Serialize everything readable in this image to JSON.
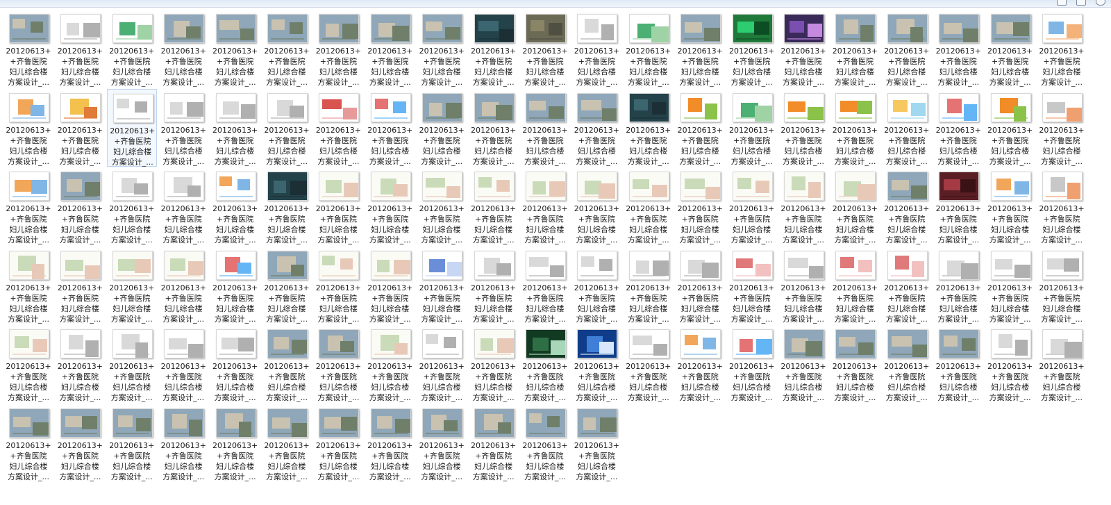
{
  "toolbar": {
    "items": [
      "",
      "",
      ""
    ],
    "icons": [
      "view-icon",
      "preview-pane-icon",
      "help-icon"
    ]
  },
  "file_label": {
    "line1": "20120613+",
    "line2": "+齐鲁医院",
    "line3": "妇儿综合楼",
    "line4": "方案设计_..."
  },
  "grid": {
    "columns": 21,
    "rows": [
      21,
      21,
      21,
      21,
      21,
      12
    ],
    "selected": [
      4,
      23
    ],
    "thumb_styles": [
      "photo",
      "doc",
      "doc-green",
      "photo",
      "photo",
      "photo",
      "photo",
      "photo",
      "photo",
      "dark",
      "aerial",
      "doc",
      "doc-green",
      "photo",
      "green",
      "purple",
      "photo",
      "photo",
      "photo",
      "photo",
      "diagram-blue",
      "doc-color",
      "diagram-yellow",
      "doc",
      "doc",
      "doc",
      "doc",
      "diagram-red",
      "diagram-color",
      "photo",
      "photo",
      "photo",
      "photo",
      "dark",
      "doc-orange",
      "doc-green",
      "doc-orange",
      "doc-orange",
      "doc-yellow",
      "diagram-color",
      "doc-orange",
      "doc-gray",
      "doc-color",
      "photo",
      "doc",
      "doc",
      "doc-color",
      "dark",
      "plan",
      "plan",
      "plan",
      "plan",
      "plan",
      "plan",
      "plan",
      "plan",
      "plan",
      "plan",
      "plan",
      "photo",
      "red",
      "doc-color",
      "doc-gray",
      "plan",
      "plan",
      "plan",
      "plan",
      "diagram-color",
      "photo",
      "plan",
      "plan",
      "doc-blue",
      "doc",
      "doc",
      "doc",
      "doc",
      "doc",
      "doc-red",
      "doc",
      "doc-red",
      "doc-red",
      "doc",
      "doc",
      "doc",
      "plan",
      "doc",
      "doc",
      "doc",
      "doc",
      "photo",
      "photo",
      "plan",
      "doc",
      "plan",
      "dark-green",
      "blue",
      "doc",
      "doc-color",
      "diagram-color",
      "photo",
      "photo",
      "photo",
      "photo",
      "doc",
      "doc",
      "photo",
      "photo",
      "photo",
      "photo",
      "photo",
      "photo",
      "photo",
      "photo",
      "photo",
      "photo",
      "photo",
      "photo"
    ]
  }
}
